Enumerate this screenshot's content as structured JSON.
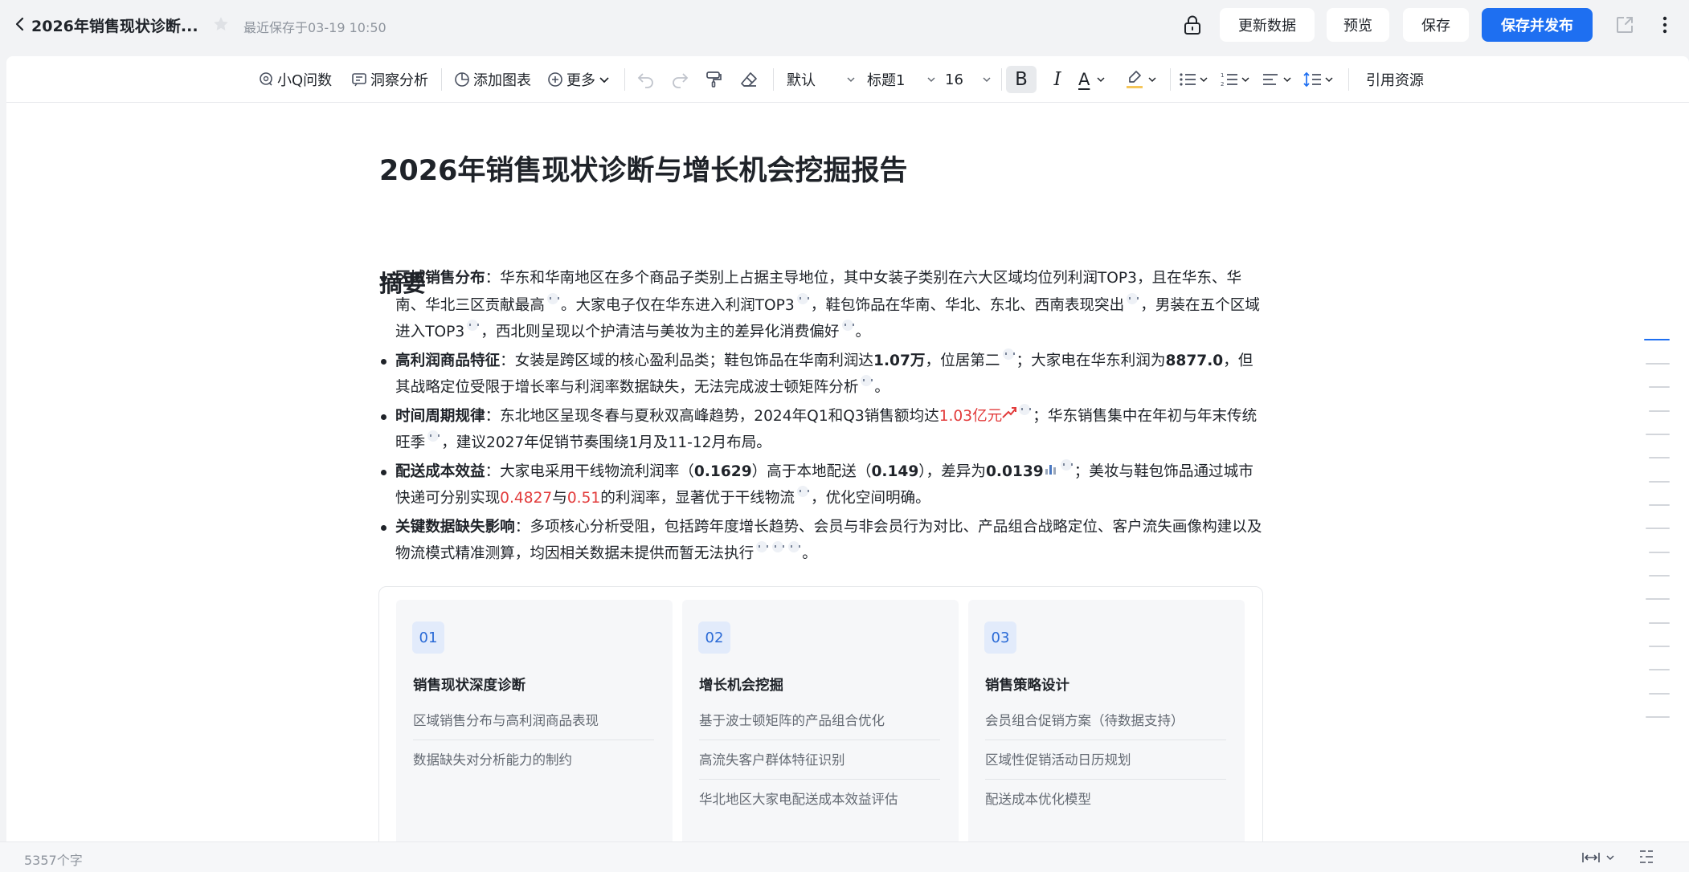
{
  "header": {
    "title": "2026年销售现状诊断...",
    "last_saved": "最近保存于03-19 10:50",
    "update_data_label": "更新数据",
    "preview_label": "预览",
    "save_label": "保存",
    "save_publish_label": "保存并发布",
    "accent_color": "#1e6ff1"
  },
  "toolbar": {
    "ask_q": "小Q问数",
    "insight": "洞察分析",
    "add_chart": "添加图表",
    "more": "更多",
    "font_family": "默认",
    "heading": "标题1",
    "font_size": "16",
    "bold": "B",
    "italic": "I",
    "font_color": "A",
    "cite_resource": "引用资源"
  },
  "document": {
    "title": "2026年销售现状诊断与增长机会挖掘报告",
    "section_title": "摘要",
    "bullets": [
      {
        "label": "区域销售分布",
        "parts": [
          "：华东和华南地区在多个商品子类别上占据主导地位，其中女装子类别在六大区域均位列利润TOP3，且在华东、华南、华北三区贡献最高",
          "。大家电子仅在华东进入利润TOP3",
          "，鞋包饰品在华南、华北、东北、西南表现突出",
          "，男装在五个区域进入TOP3",
          "，西北则呈现以个护清洁与美妆为主的差异化消费偏好",
          "。"
        ]
      },
      {
        "label": "高利润商品特征",
        "text1": "：女装是跨区域的核心盈利品类；鞋包饰品在华南利润达",
        "value1": "1.07万",
        "text2": "，位居第二",
        "text3": "；大家电在华东利润为",
        "value2": "8877.0",
        "text4": "，但其战略定位受限于增长率与利润率数据缺失，无法完成波士顿矩阵分析",
        "text5": "。"
      },
      {
        "label": "时间周期规律",
        "text1": "：东北地区呈现冬春与夏秋双高峰趋势，2024年Q1和Q3销售额均达",
        "value1": "1.03亿元",
        "text2": "；华东销售集中在年初与年末传统旺季",
        "text3": "，建议2027年促销节奏围绕1月及11-12月布局。"
      },
      {
        "label": "配送成本效益",
        "text1": "：大家电采用干线物流利润率（",
        "value1": "0.1629",
        "text2": "）高于本地配送（",
        "value2": "0.149",
        "text3": "），差异为",
        "value3": "0.0139",
        "text4": "；美妆与鞋包饰品通过城市快递可分别实现",
        "value4": "0.4827",
        "text5": "与",
        "value5": "0.51",
        "text6": "的利润率，显著优于干线物流",
        "text7": "，优化空间明确。"
      },
      {
        "label": "关键数据缺失影响",
        "text1": "：多项核心分析受阻，包括跨年度增长趋势、会员与非会员行为对比、产品组合战略定位、客户流失画像构建以及物流模式精准测算，均因相关数据未提供而暂无法执行",
        "text2": "。"
      }
    ],
    "cards": [
      {
        "num": "01",
        "title": "销售现状深度诊断",
        "items": [
          "区域销售分布与高利润商品表现",
          "数据缺失对分析能力的制约"
        ]
      },
      {
        "num": "02",
        "title": "增长机会挖掘",
        "items": [
          "基于波士顿矩阵的产品组合优化",
          "高流失客户群体特征识别",
          "华北地区大家电配送成本效益评估"
        ]
      },
      {
        "num": "03",
        "title": "销售策略设计",
        "items": [
          "会员组合促销方案（待数据支持）",
          "区域性促销活动日历规划",
          "配送成本优化模型"
        ]
      }
    ]
  },
  "status": {
    "word_count": "5357个字"
  }
}
